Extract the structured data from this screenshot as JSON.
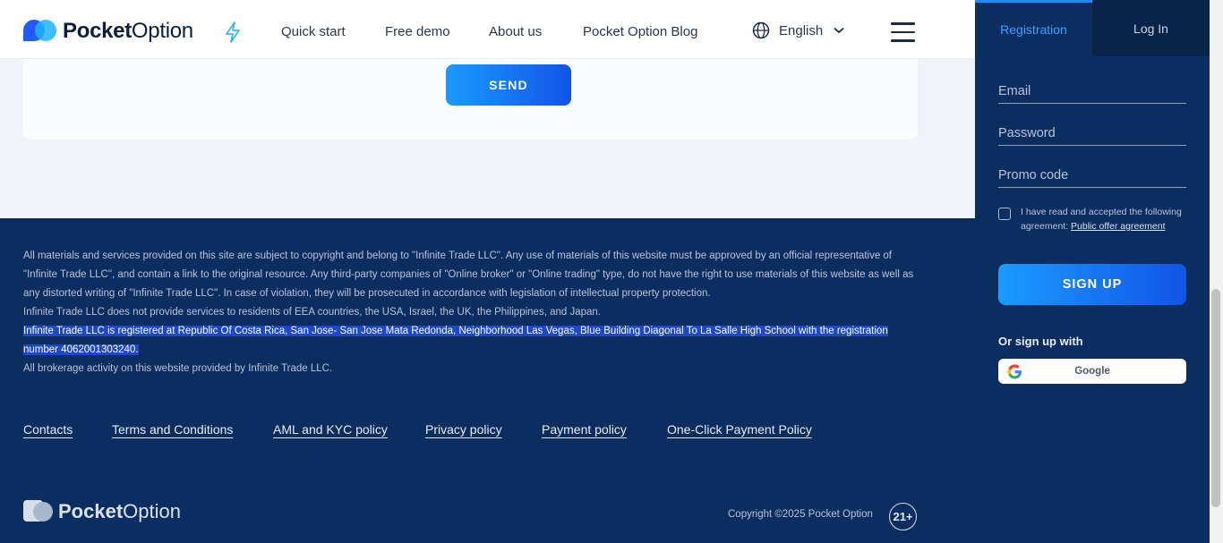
{
  "header": {
    "logo_bold": "Pocket",
    "logo_light": "Option",
    "nav": [
      "Quick start",
      "Free demo",
      "About us",
      "Pocket Option Blog"
    ],
    "language": "English"
  },
  "contact_form": {
    "send_label": "SEND"
  },
  "footer": {
    "legal_1": "All materials and services provided on this site are subject to copyright and belong to \"Infinite Trade LLC\". Any use of materials of this website must be approved by an official representative of \"Infinite Trade LLC\", and contain a link to the original resource. Any third-party companies of \"Online broker\" or \"Online trading\" type, do not have the right to use materials of this website as well as any distorted writing of \"Infinite Trade LLC\". In case of violation, they will be prosecuted in accordance with legislation of intellectual property protection.",
    "legal_2": "Infinite Trade LLC does not provide services to residents of EEA countries, the USA, Israel, the UK, the Philippines, and Japan.",
    "legal_3": "Infinite Trade LLC is registered at Republic Of Costa Rica, San Jose- San Jose Mata Redonda, Neighborhood Las Vegas, Blue Building Diagonal To La Salle High School with the registration number 4062001303240.",
    "legal_4": "All brokerage activity on this website provided by Infinite Trade LLC.",
    "links": [
      "Contacts",
      "Terms and Conditions",
      "AML and KYC policy",
      "Privacy policy",
      "Payment policy",
      "One-Click Payment Policy"
    ],
    "logo_bold": "Pocket",
    "logo_light": "Option",
    "copyright": "Copyright ©2025 Pocket Option",
    "age_badge": "21+"
  },
  "auth_panel": {
    "tab_registration": "Registration",
    "tab_login": "Log In",
    "email_placeholder": "Email",
    "password_placeholder": "Password",
    "promo_placeholder": "Promo code",
    "agreement_text": "I have read and accepted the following agreement: ",
    "agreement_link": "Public offer agreement",
    "signup_label": "SIGN UP",
    "or_signup": "Or sign up with",
    "google_label": "Google"
  },
  "colors": {
    "brand_blue": "#1254e6",
    "accent_blue": "#1a9bff",
    "footer_bg": "#0c2d5f"
  }
}
